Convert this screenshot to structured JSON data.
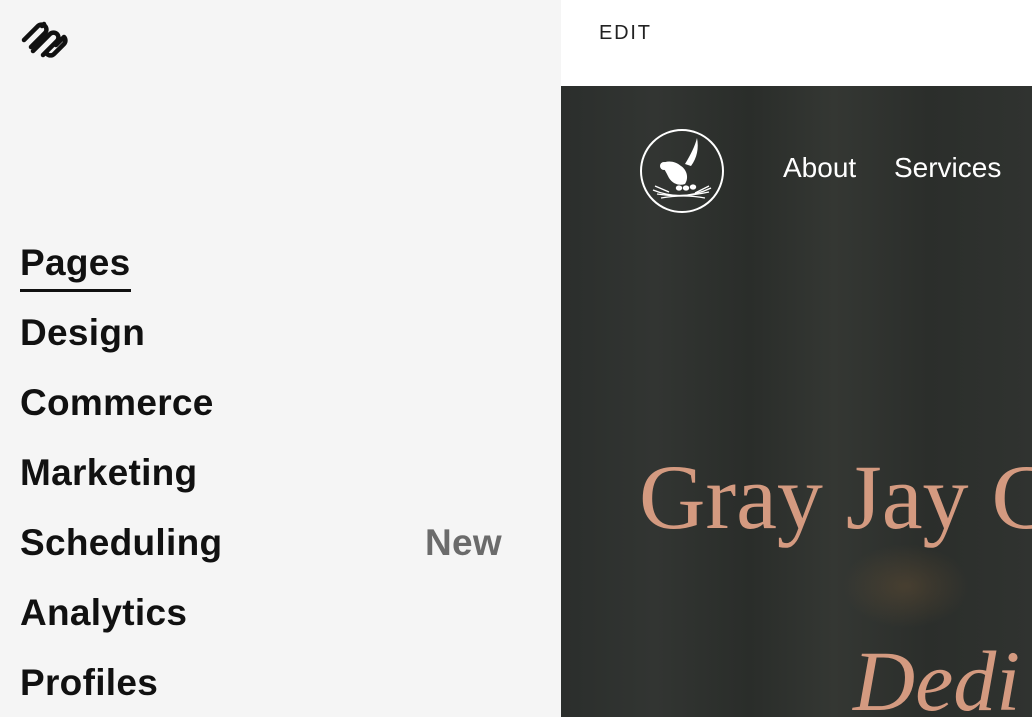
{
  "sidebar": {
    "logo_icon": "squarespace-logo-icon",
    "items": [
      {
        "label": "Pages",
        "active": true
      },
      {
        "label": "Design"
      },
      {
        "label": "Commerce"
      },
      {
        "label": "Marketing"
      },
      {
        "label": "Scheduling",
        "badge": "New"
      },
      {
        "label": "Analytics"
      },
      {
        "label": "Profiles"
      }
    ]
  },
  "preview": {
    "edit_label": "EDIT",
    "site": {
      "logo_icon": "bird-nest-logo-icon",
      "nav": [
        "About",
        "Services"
      ],
      "hero_title": "Gray Jay C",
      "hero_subtitle": "Dedi"
    }
  },
  "colors": {
    "sidebar_bg": "#f5f5f5",
    "accent_text": "#d49a80",
    "site_bg": "#2e312e",
    "badge_text": "#6b6b6b"
  }
}
